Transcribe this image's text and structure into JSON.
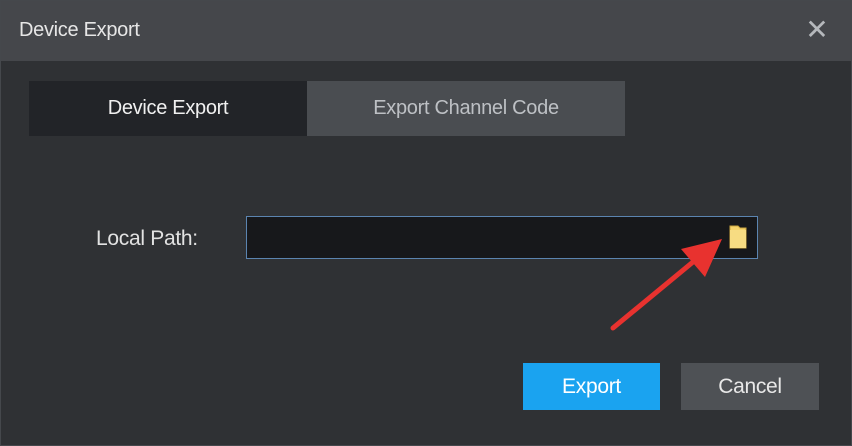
{
  "window": {
    "title": "Device Export",
    "close_icon": "close-icon"
  },
  "tabs": [
    {
      "label": "Device Export",
      "active": true
    },
    {
      "label": "Export Channel Code",
      "active": false
    }
  ],
  "form": {
    "local_path_label": "Local Path:",
    "local_path_value": "",
    "browse_icon": "folder-icon"
  },
  "buttons": {
    "export_label": "Export",
    "cancel_label": "Cancel"
  },
  "colors": {
    "accent": "#1aa3f0",
    "annotation_arrow": "#e8322f",
    "folder_icon": "#f5d36b"
  }
}
